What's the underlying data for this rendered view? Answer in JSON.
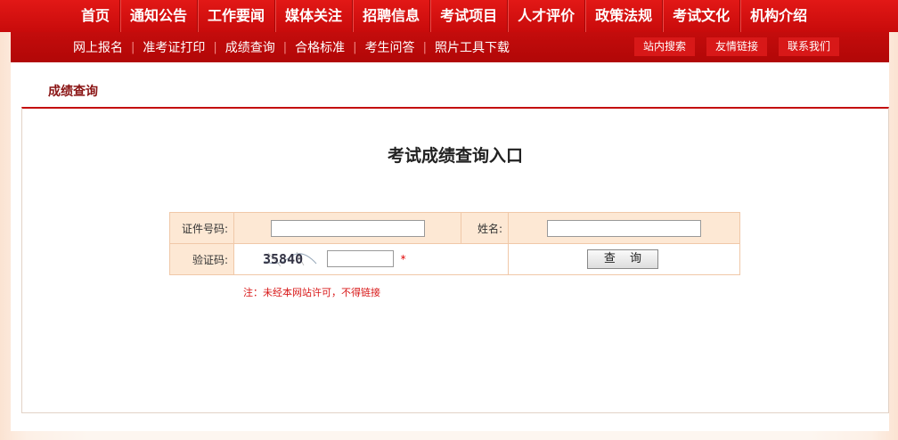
{
  "top_nav": [
    "首页",
    "通知公告",
    "工作要闻",
    "媒体关注",
    "招聘信息",
    "考试项目",
    "人才评价",
    "政策法规",
    "考试文化",
    "机构介绍"
  ],
  "sub_nav": {
    "links": [
      "网上报名",
      "准考证打印",
      "成绩查询",
      "合格标准",
      "考生问答",
      "照片工具下载"
    ],
    "separator": "|",
    "buttons": [
      "站内搜索",
      "友情链接",
      "联系我们"
    ]
  },
  "breadcrumb": "成绩查询",
  "form": {
    "title": "考试成绩查询入口",
    "id_label": "证件号码:",
    "id_value": "",
    "name_label": "姓名:",
    "name_value": "",
    "captcha_label": "验证码:",
    "captcha_text": "35840",
    "captcha_value": "",
    "required_mark": "*",
    "submit_label": "查 询",
    "note": "注：未经本网站许可，不得链接"
  },
  "colors": {
    "nav_red": "#d11010",
    "subnav_red": "#b90909",
    "accent": "#c40c0c",
    "label_bg": "#fde8d4",
    "note_red": "#d81818"
  }
}
